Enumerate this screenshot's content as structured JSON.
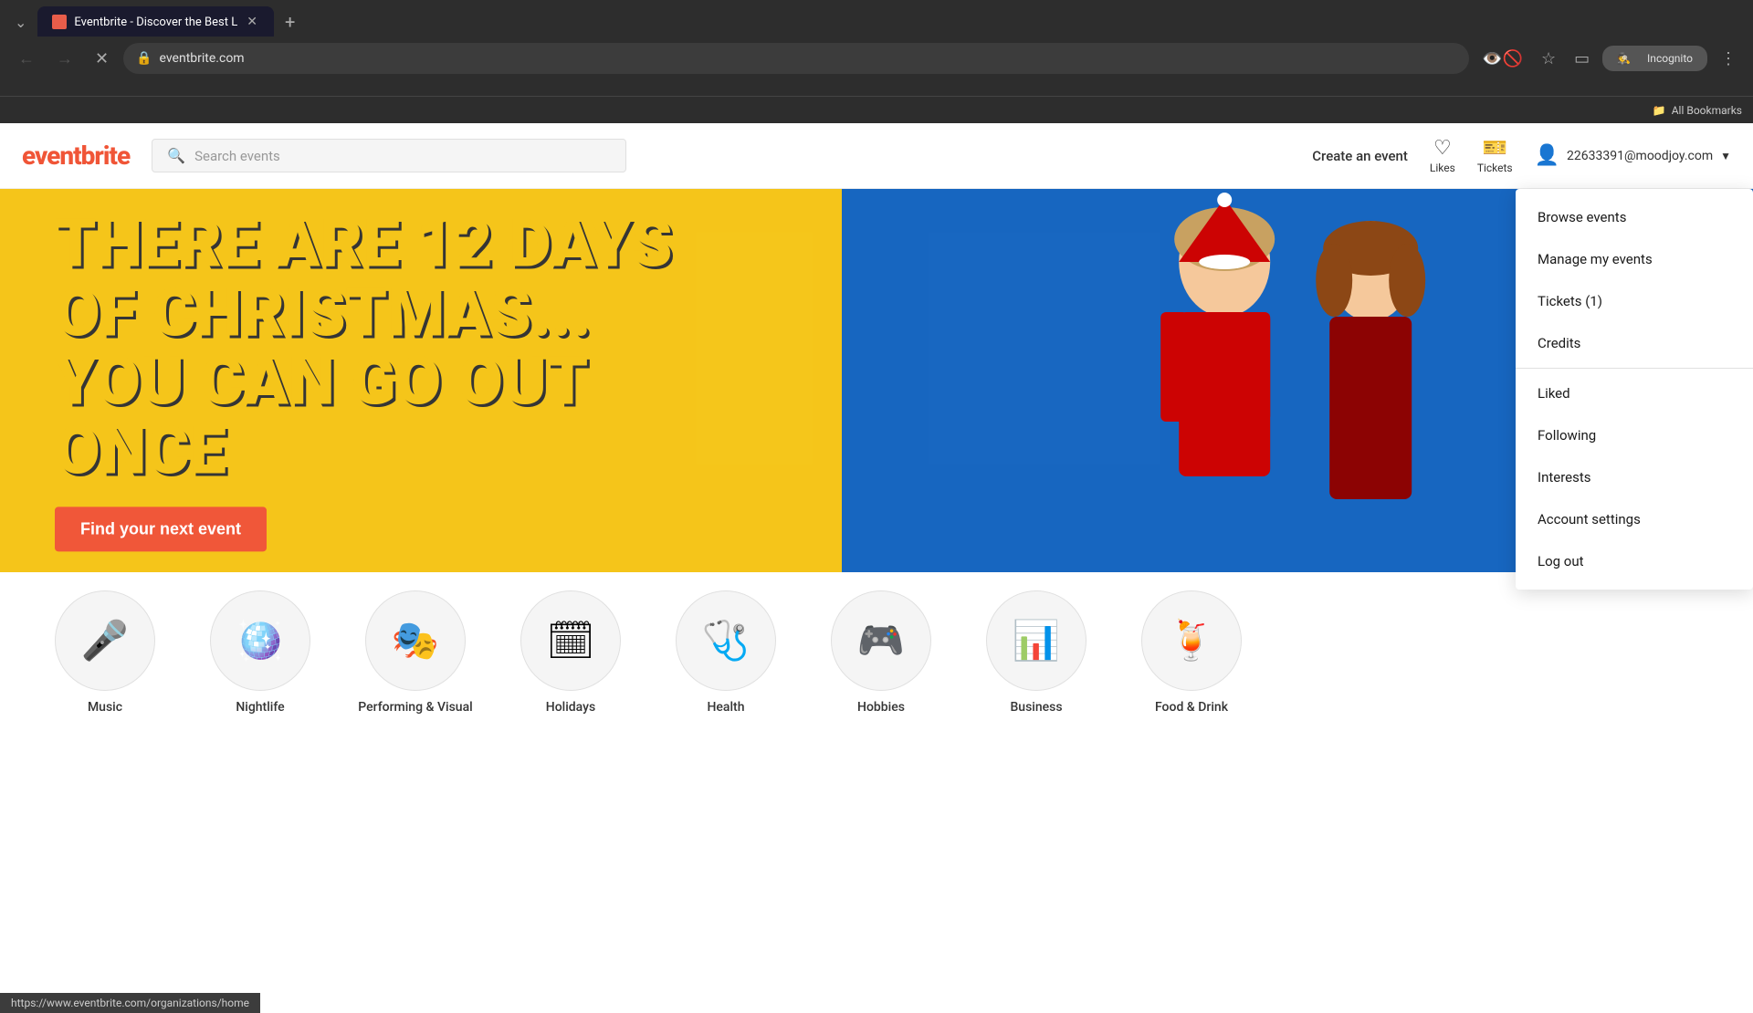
{
  "browser": {
    "tab_title": "Eventbrite - Discover the Best L",
    "url": "eventbrite.com",
    "incognito_label": "Incognito",
    "bookmarks_label": "All Bookmarks"
  },
  "navbar": {
    "logo": "eventbrite",
    "search_placeholder": "Search events",
    "create_event": "Create an event",
    "likes_label": "Likes",
    "tickets_label": "Tickets",
    "user_email": "22633391@moodjoy.com"
  },
  "hero": {
    "line1": "THERE ARE 12 DAYS",
    "line2": "OF CHRISTMAS...",
    "line3": "YOU CAN GO OUT ONCE",
    "cta": "Find your next event"
  },
  "dropdown": {
    "items": [
      "Browse events",
      "Manage my events",
      "Tickets (1)",
      "Credits",
      "Liked",
      "Following",
      "Interests",
      "Account settings",
      "Log out"
    ]
  },
  "categories": [
    {
      "icon": "🎤",
      "label": "Music"
    },
    {
      "icon": "🪩",
      "label": "Nightlife"
    },
    {
      "icon": "🎭",
      "label": "Performing & Visual"
    },
    {
      "icon": "🗓",
      "label": "Holidays"
    },
    {
      "icon": "🩺",
      "label": "Health"
    },
    {
      "icon": "🎮",
      "label": "Hobbies"
    },
    {
      "icon": "📊",
      "label": "Business"
    },
    {
      "icon": "🍹",
      "label": "Food & Drink"
    }
  ],
  "status_bar": {
    "url": "https://www.eventbrite.com/organizations/home"
  }
}
